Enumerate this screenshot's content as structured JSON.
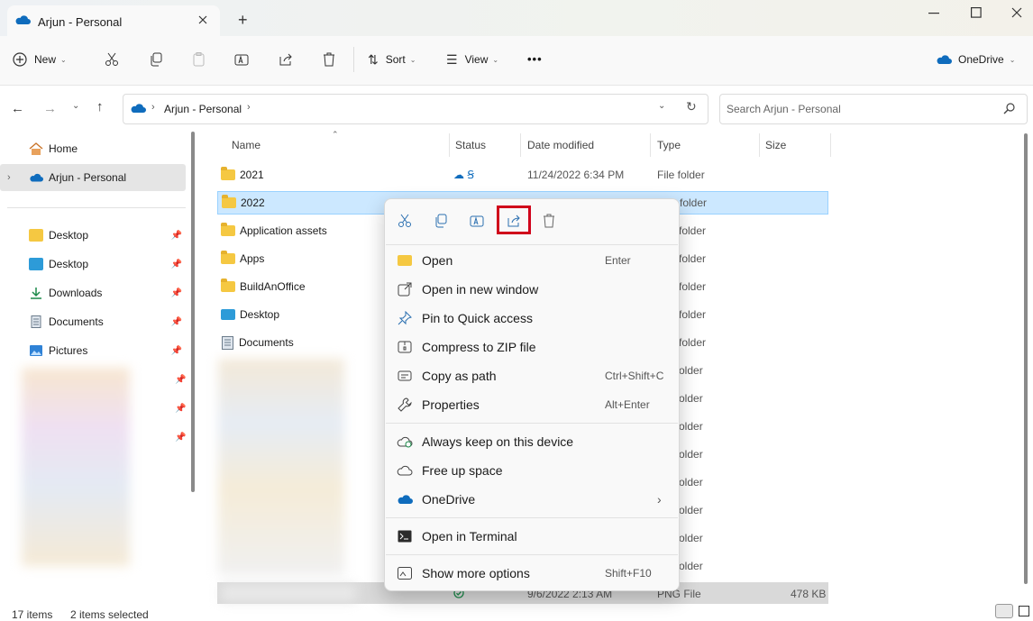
{
  "window": {
    "tab_title": "Arjun - Personal",
    "new_tab": "+"
  },
  "toolbar": {
    "new_label": "New",
    "sort_label": "Sort",
    "view_label": "View",
    "more": "•••",
    "onedrive_label": "OneDrive"
  },
  "address": {
    "location": "Arjun - Personal",
    "search_placeholder": "Search Arjun - Personal"
  },
  "nav": {
    "home": "Home",
    "onedrive": "Arjun - Personal",
    "quick": [
      {
        "label": "Desktop",
        "icon": "folder-icon"
      },
      {
        "label": "Desktop",
        "icon": "desktop-icon"
      },
      {
        "label": "Downloads",
        "icon": "download-icon"
      },
      {
        "label": "Documents",
        "icon": "document-icon"
      },
      {
        "label": "Pictures",
        "icon": "pictures-icon"
      }
    ]
  },
  "columns": {
    "name": "Name",
    "status": "Status",
    "date": "Date modified",
    "type": "Type",
    "size": "Size"
  },
  "files": [
    {
      "name": "2021",
      "date": "11/24/2022 6:34 PM",
      "type": "File folder"
    },
    {
      "name": "2022",
      "date": "",
      "type": "folder"
    },
    {
      "name": "Application assets",
      "type": "folder"
    },
    {
      "name": "Apps",
      "type": "folder"
    },
    {
      "name": "BuildAnOffice",
      "type": "folder"
    },
    {
      "name": "Desktop",
      "type": "folder"
    },
    {
      "name": "Documents",
      "type": "folder"
    }
  ],
  "hidden_rows_type": "older",
  "last_row": {
    "date": "9/6/2022 2:13 AM",
    "type": "PNG File",
    "size": "478 KB"
  },
  "context_menu": {
    "items": [
      {
        "label": "Open",
        "shortcut": "Enter"
      },
      {
        "label": "Open in new window",
        "shortcut": ""
      },
      {
        "label": "Pin to Quick access",
        "shortcut": ""
      },
      {
        "label": "Compress to ZIP file",
        "shortcut": ""
      },
      {
        "label": "Copy as path",
        "shortcut": "Ctrl+Shift+C"
      },
      {
        "label": "Properties",
        "shortcut": "Alt+Enter"
      },
      {
        "label": "Always keep on this device",
        "shortcut": ""
      },
      {
        "label": "Free up space",
        "shortcut": ""
      },
      {
        "label": "OneDrive",
        "shortcut": ""
      },
      {
        "label": "Open in Terminal",
        "shortcut": ""
      },
      {
        "label": "Show more options",
        "shortcut": "Shift+F10"
      }
    ]
  },
  "status": {
    "items": "17 items",
    "selected": "2 items selected"
  },
  "colors": {
    "selection": "#cce8ff",
    "highlight_box": "#d0021b",
    "onedrive_blue": "#0f6cbd"
  }
}
